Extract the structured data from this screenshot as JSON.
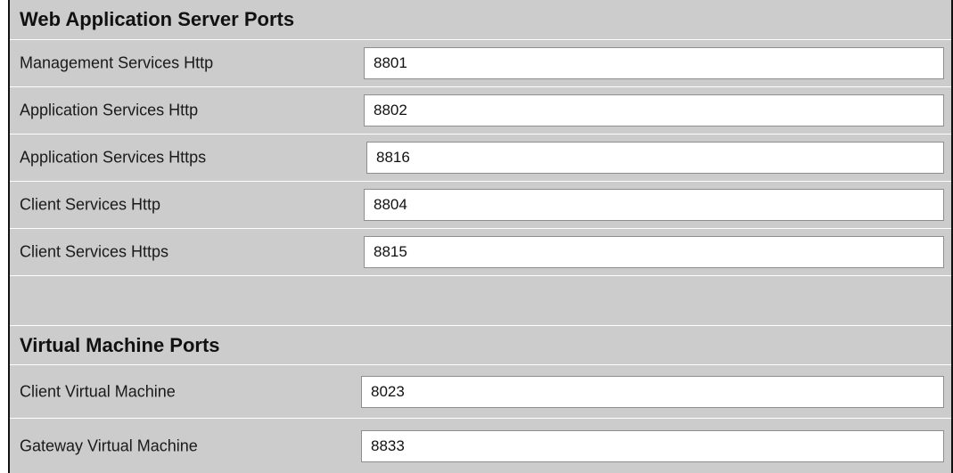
{
  "sections": [
    {
      "title": "Web Application Server Ports",
      "fields": [
        {
          "label": "Management Services Http",
          "value": "8801"
        },
        {
          "label": "Application Services Http",
          "value": "8802"
        },
        {
          "label": "Application Services Https",
          "value": "8816"
        },
        {
          "label": "Client Services Http",
          "value": "8804"
        },
        {
          "label": "Client Services Https",
          "value": "8815"
        }
      ]
    },
    {
      "title": "Virtual Machine Ports",
      "fields": [
        {
          "label": "Client Virtual Machine",
          "value": "8023"
        },
        {
          "label": "Gateway Virtual Machine",
          "value": "8833"
        }
      ]
    }
  ]
}
